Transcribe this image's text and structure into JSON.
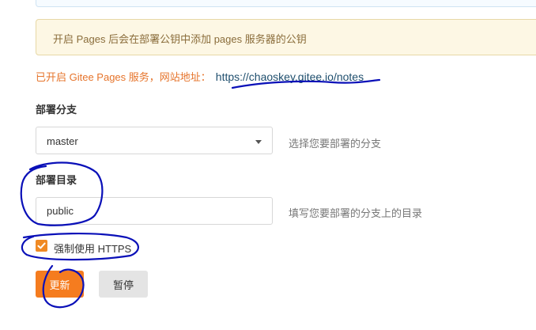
{
  "notice": {
    "text": "开启 Pages 后会在部署公钥中添加 pages 服务器的公钥"
  },
  "status": {
    "label": "已开启 Gitee Pages 服务，网站地址：",
    "url": "https://chaoskey.gitee.io/notes"
  },
  "branch": {
    "label": "部署分支",
    "value": "master",
    "hint": "选择您要部署的分支"
  },
  "directory": {
    "label": "部署目录",
    "value": "public",
    "hint": "填写您要部署的分支上的目录"
  },
  "https": {
    "label": "强制使用 HTTPS",
    "checked": true
  },
  "buttons": {
    "update": "更新",
    "pause": "暂停"
  },
  "colors": {
    "accent": "#f57c1f",
    "annotation": "#0a10b8",
    "link": "#1f4f6e"
  }
}
